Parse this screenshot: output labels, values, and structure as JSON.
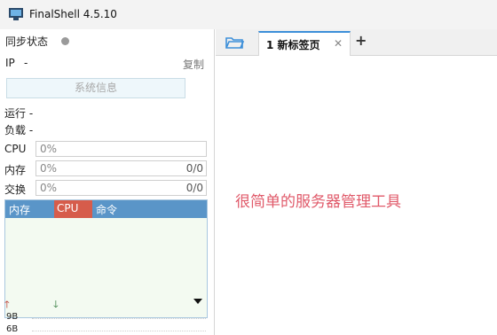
{
  "window": {
    "title": "FinalShell 4.5.10",
    "icon": "finalshell-logo-icon"
  },
  "sidebar": {
    "sync_label": "同步状态",
    "ip_label": "IP",
    "ip_value": "-",
    "copy_label": "复制",
    "sysinfo_label": "系统信息",
    "run_label": "运行 -",
    "load_label": "负载 -",
    "metrics": [
      {
        "label": "CPU",
        "percent": "0%",
        "total": ""
      },
      {
        "label": "内存",
        "percent": "0%",
        "total": "0/0"
      },
      {
        "label": "交换",
        "percent": "0%",
        "total": "0/0"
      }
    ],
    "process_table": {
      "columns": [
        "内存",
        "CPU",
        "命令"
      ],
      "sorted_column": "CPU"
    },
    "network": {
      "upload_icon": "arrow-up-icon",
      "download_icon": "arrow-down-icon",
      "values": [
        "9B",
        "6B"
      ]
    }
  },
  "tabs": [
    {
      "label": "1 新标签页",
      "active": true
    }
  ],
  "content": {
    "annotation": "很简单的服务器管理工具"
  },
  "colors": {
    "accent": "#3d8fd9",
    "table_header": "#5a95c8",
    "cpu_header": "#d65c4b",
    "annotation": "#e05a6a"
  }
}
